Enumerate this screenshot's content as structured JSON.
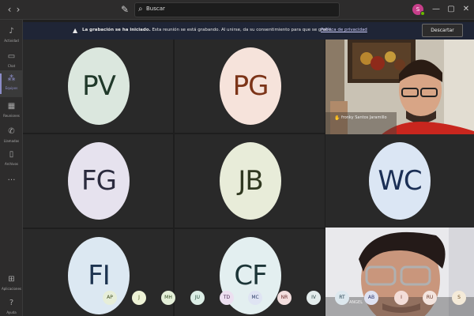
{
  "titlebar": {
    "back_icon": "chevron-left-icon",
    "forward_icon": "chevron-right-icon",
    "compose_icon": "compose-icon",
    "search_placeholder": "Buscar",
    "user_avatar_initial": "S",
    "more_label": "…",
    "minimize_label": "—",
    "maximize_label": "▢",
    "close_label": "✕"
  },
  "rail": {
    "items": [
      {
        "label": "Actividad",
        "icon": "bell-icon"
      },
      {
        "label": "Chat",
        "icon": "chat-icon"
      },
      {
        "label": "Equipos",
        "icon": "teams-icon"
      },
      {
        "label": "Reuniones",
        "icon": "calendar-icon"
      },
      {
        "label": "Llamadas",
        "icon": "phone-icon"
      },
      {
        "label": "Archivos",
        "icon": "file-icon"
      },
      {
        "label": "…",
        "icon": "more-icon"
      }
    ],
    "bottom": [
      {
        "label": "Aplicaciones",
        "icon": "apps-icon"
      },
      {
        "label": "Ayuda",
        "icon": "help-icon"
      }
    ]
  },
  "banner": {
    "bold": "La grabación se ha iniciado.",
    "text": "Esta reunión se está grabando. Al unirse, da su consentimiento para que se grabe.",
    "link": "Política de privacidad",
    "dismiss": "Descartar"
  },
  "participants": [
    {
      "initials": "PV",
      "bg": "#dbe7de",
      "fg": "#20392a"
    },
    {
      "initials": "PG",
      "bg": "#f6e3db",
      "fg": "#7c3418"
    },
    {
      "initials": "FG",
      "bg": "#e6e2ee",
      "fg": "#2b2b3e"
    },
    {
      "initials": "JB",
      "bg": "#e8ecd9",
      "fg": "#303820"
    },
    {
      "initials": "WC",
      "bg": "#dbe6f4",
      "fg": "#1b2f55"
    },
    {
      "initials": "FI",
      "bg": "#dce8f2",
      "fg": "#1d3350"
    },
    {
      "initials": "CF",
      "bg": "#e3eff0",
      "fg": "#1c3537"
    }
  ],
  "video1": {
    "name": "fronky Santos Jaramillo"
  },
  "video2": {
    "name": "ANGEL"
  },
  "chips": [
    {
      "label": "AP",
      "bg": "#e7eed9",
      "fg": "#3a4a1e"
    },
    {
      "label": "J",
      "bg": "#eef3d6",
      "fg": "#48541c"
    },
    {
      "label": "MH",
      "bg": "#e4efd8",
      "fg": "#2e4a1e"
    },
    {
      "label": "JU",
      "bg": "#dceee6",
      "fg": "#1e4a34"
    },
    {
      "label": "TD",
      "bg": "#ecdff0",
      "fg": "#4a2a55"
    },
    {
      "label": "MC",
      "bg": "#dfe4f3",
      "fg": "#293a66"
    },
    {
      "label": "NR",
      "bg": "#f2dede",
      "fg": "#6a2a2a"
    },
    {
      "label": "IV",
      "bg": "#e3ecec",
      "fg": "#2a4646"
    },
    {
      "label": "RT",
      "bg": "#dde8ee",
      "fg": "#24404e"
    },
    {
      "label": "AB",
      "bg": "#dfe2f2",
      "fg": "#2a3268"
    },
    {
      "label": "I",
      "bg": "#f3ddd8",
      "fg": "#6e2e22"
    },
    {
      "label": "RU",
      "bg": "#f3e4de",
      "fg": "#6b3a2a"
    },
    {
      "label": "S",
      "bg": "#f4ead8",
      "fg": "#6a4a1e"
    }
  ]
}
